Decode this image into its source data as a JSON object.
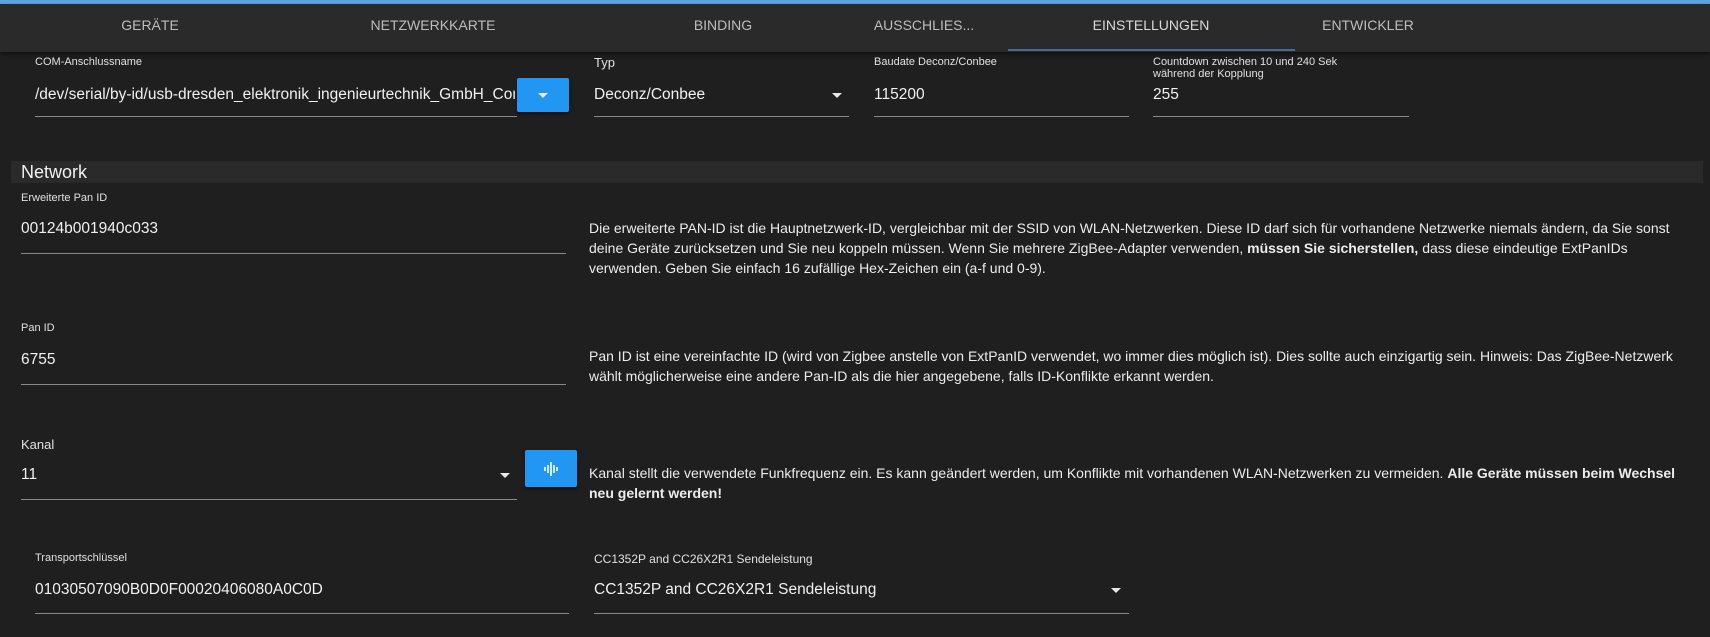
{
  "tabs": [
    {
      "label": "GERÄTE"
    },
    {
      "label": "NETZWERKKARTE"
    },
    {
      "label": "BINDING"
    },
    {
      "label": "AUSSCHLIES..."
    },
    {
      "label": "EINSTELLUNGEN",
      "active": true
    },
    {
      "label": "ENTWICKLER"
    }
  ],
  "com": {
    "label": "COM-Anschlussname",
    "value": "/dev/serial/by-id/usb-dresden_elektronik_ingenieurtechnik_GmbH_Conbee"
  },
  "typ": {
    "label": "Typ",
    "value": "Deconz/Conbee"
  },
  "baud": {
    "label": "Baudate Deconz/Conbee",
    "value": "115200"
  },
  "countdown": {
    "label_line1": "Countdown zwischen 10 und 240 Sek",
    "label_line2": "während der Kopplung",
    "value": "255"
  },
  "network": {
    "title": "Network"
  },
  "extpan": {
    "label": "Erweiterte Pan ID",
    "value": "00124b001940c033",
    "desc_1": "Die erweiterte PAN-ID ist die Hauptnetzwerk-ID, vergleichbar mit der SSID von WLAN-Netzwerken. Diese ID darf sich für vorhandene Netzwerke niemals ändern, da Sie sonst deine Geräte zurücksetzen und Sie neu koppeln müssen. Wenn Sie mehrere ZigBee-Adapter verwenden, ",
    "desc_bold": "müssen Sie sicherstellen,",
    "desc_2": " dass diese eindeutige ExtPanIDs verwenden. Geben Sie einfach 16 zufällige Hex-Zeichen ein (a-f und 0-9)."
  },
  "panid": {
    "label": "Pan ID",
    "value": "6755",
    "desc": "Pan ID ist eine vereinfachte ID (wird von Zigbee anstelle von ExtPanID verwendet, wo immer dies möglich ist). Dies sollte auch einzigartig sein. Hinweis: Das ZigBee-Netzwerk wählt möglicherweise eine andere Pan-ID als die hier angegebene, falls ID-Konflikte erkannt werden."
  },
  "kanal": {
    "label": "Kanal",
    "value": "11",
    "desc_1": "Kanal stellt die verwendete Funkfrequenz ein. Es kann geändert werden, um Konflikte mit vorhandenen WLAN-Netzwerken zu vermeiden. ",
    "desc_bold": "Alle Geräte müssen beim Wechsel neu gelernt werden!"
  },
  "transport": {
    "label": "Transportschlüssel",
    "value": "01030507090B0D0F00020406080A0C0D"
  },
  "power": {
    "label": "CC1352P and CC26X2R1 Sendeleistung",
    "value": "CC1352P and CC26X2R1 Sendeleistung"
  }
}
